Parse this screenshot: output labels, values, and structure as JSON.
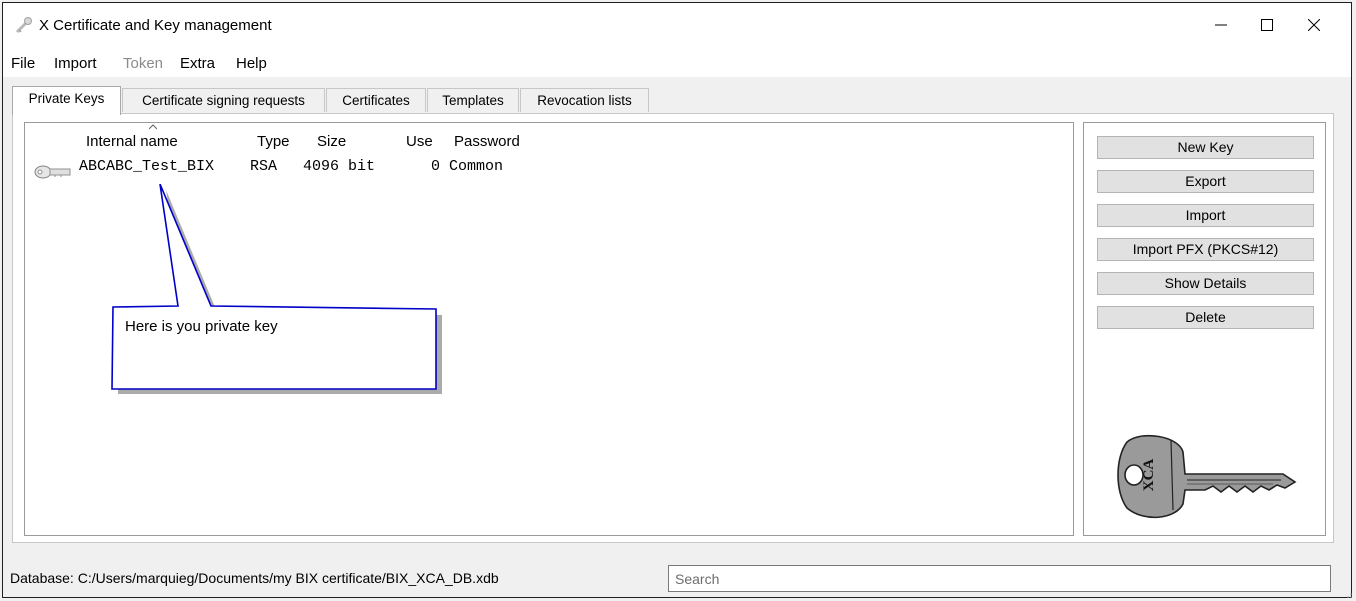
{
  "window": {
    "title": "X Certificate and Key management",
    "icons": {
      "app": "key-icon",
      "minimize": "minimize-icon",
      "maximize": "maximize-icon",
      "close": "close-icon"
    }
  },
  "menu": [
    "File",
    "Import",
    "Token",
    "Extra",
    "Help"
  ],
  "menu_disabled": [
    "Token"
  ],
  "tabs": [
    "Private Keys",
    "Certificate signing requests",
    "Certificates",
    "Templates",
    "Revocation lists"
  ],
  "active_tab": "Private Keys",
  "table": {
    "columns": [
      "Internal name",
      "Type",
      "Size",
      "Use",
      "Password"
    ],
    "sorted_column": "Internal name",
    "rows": [
      {
        "icon": "key-icon",
        "internal_name": "ABCABC_Test_BIX",
        "type": "RSA",
        "size": "4096 bit",
        "use": "0",
        "password": "Common"
      }
    ]
  },
  "callout": {
    "text": "Here is you private key",
    "border_color": "#0000c8"
  },
  "buttons": [
    "New Key",
    "Export",
    "Import",
    "Import PFX (PKCS#12)",
    "Show Details",
    "Delete"
  ],
  "key_image": {
    "icon": "xca-key-image",
    "text": "XCA"
  },
  "status": {
    "database": "Database: C:/Users/marquieg/Documents/my BIX certificate/BIX_XCA_DB.xdb"
  },
  "search": {
    "placeholder": "Search",
    "value": ""
  }
}
